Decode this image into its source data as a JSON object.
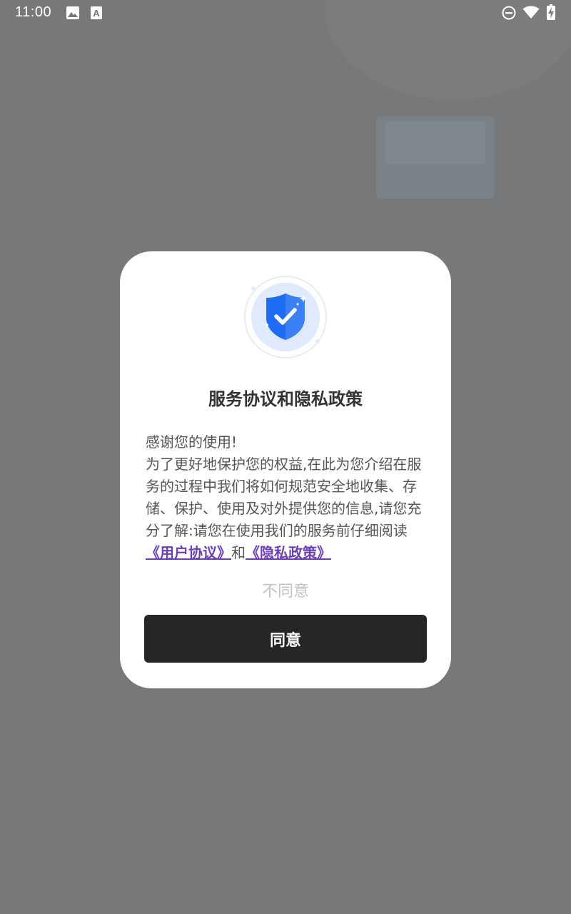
{
  "status_bar": {
    "time": "11:00",
    "left_icons": [
      "image-icon",
      "text-a-icon"
    ],
    "right_icons": [
      "do-not-disturb-icon",
      "wifi-icon",
      "battery-charging-icon"
    ]
  },
  "dialog": {
    "icon": "shield-check-icon",
    "title": "服务协议和隐私政策",
    "body": {
      "greeting": "感谢您的使用!",
      "paragraph": "为了更好地保护您的权益,在此为您介绍在服务的过程中我们将如何规范安全地收集、存储、保护、使用及对外提供您的信息,请您充分了解:请您在使用我们的服务前仔细阅读",
      "user_agreement_link": "《用户协议》",
      "conjunction": "和",
      "privacy_policy_link": "《隐私政策》"
    },
    "disagree_label": "不同意",
    "agree_label": "同意"
  },
  "colors": {
    "scrim": "#777879",
    "dialog_bg": "#ffffff",
    "shield_blue": "#1f6cf5",
    "link": "#6a3fb8",
    "agree_button_bg": "#262626",
    "disagree_text": "#c3c3c3"
  }
}
